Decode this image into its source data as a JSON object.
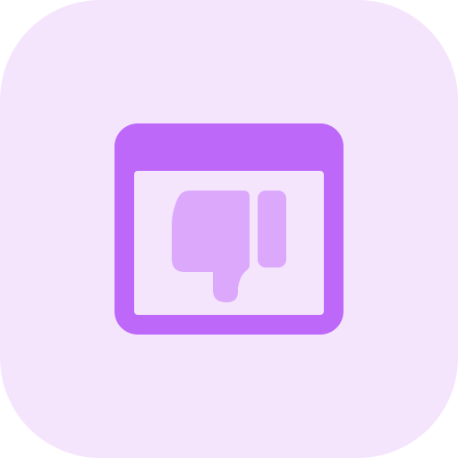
{
  "icon": {
    "name": "browser-thumbs-down-icon",
    "colors": {
      "background": "#f4e5fd",
      "frame": "#bd68f9",
      "screen": "#f4e5fd",
      "hand": "#dca8fc"
    }
  }
}
